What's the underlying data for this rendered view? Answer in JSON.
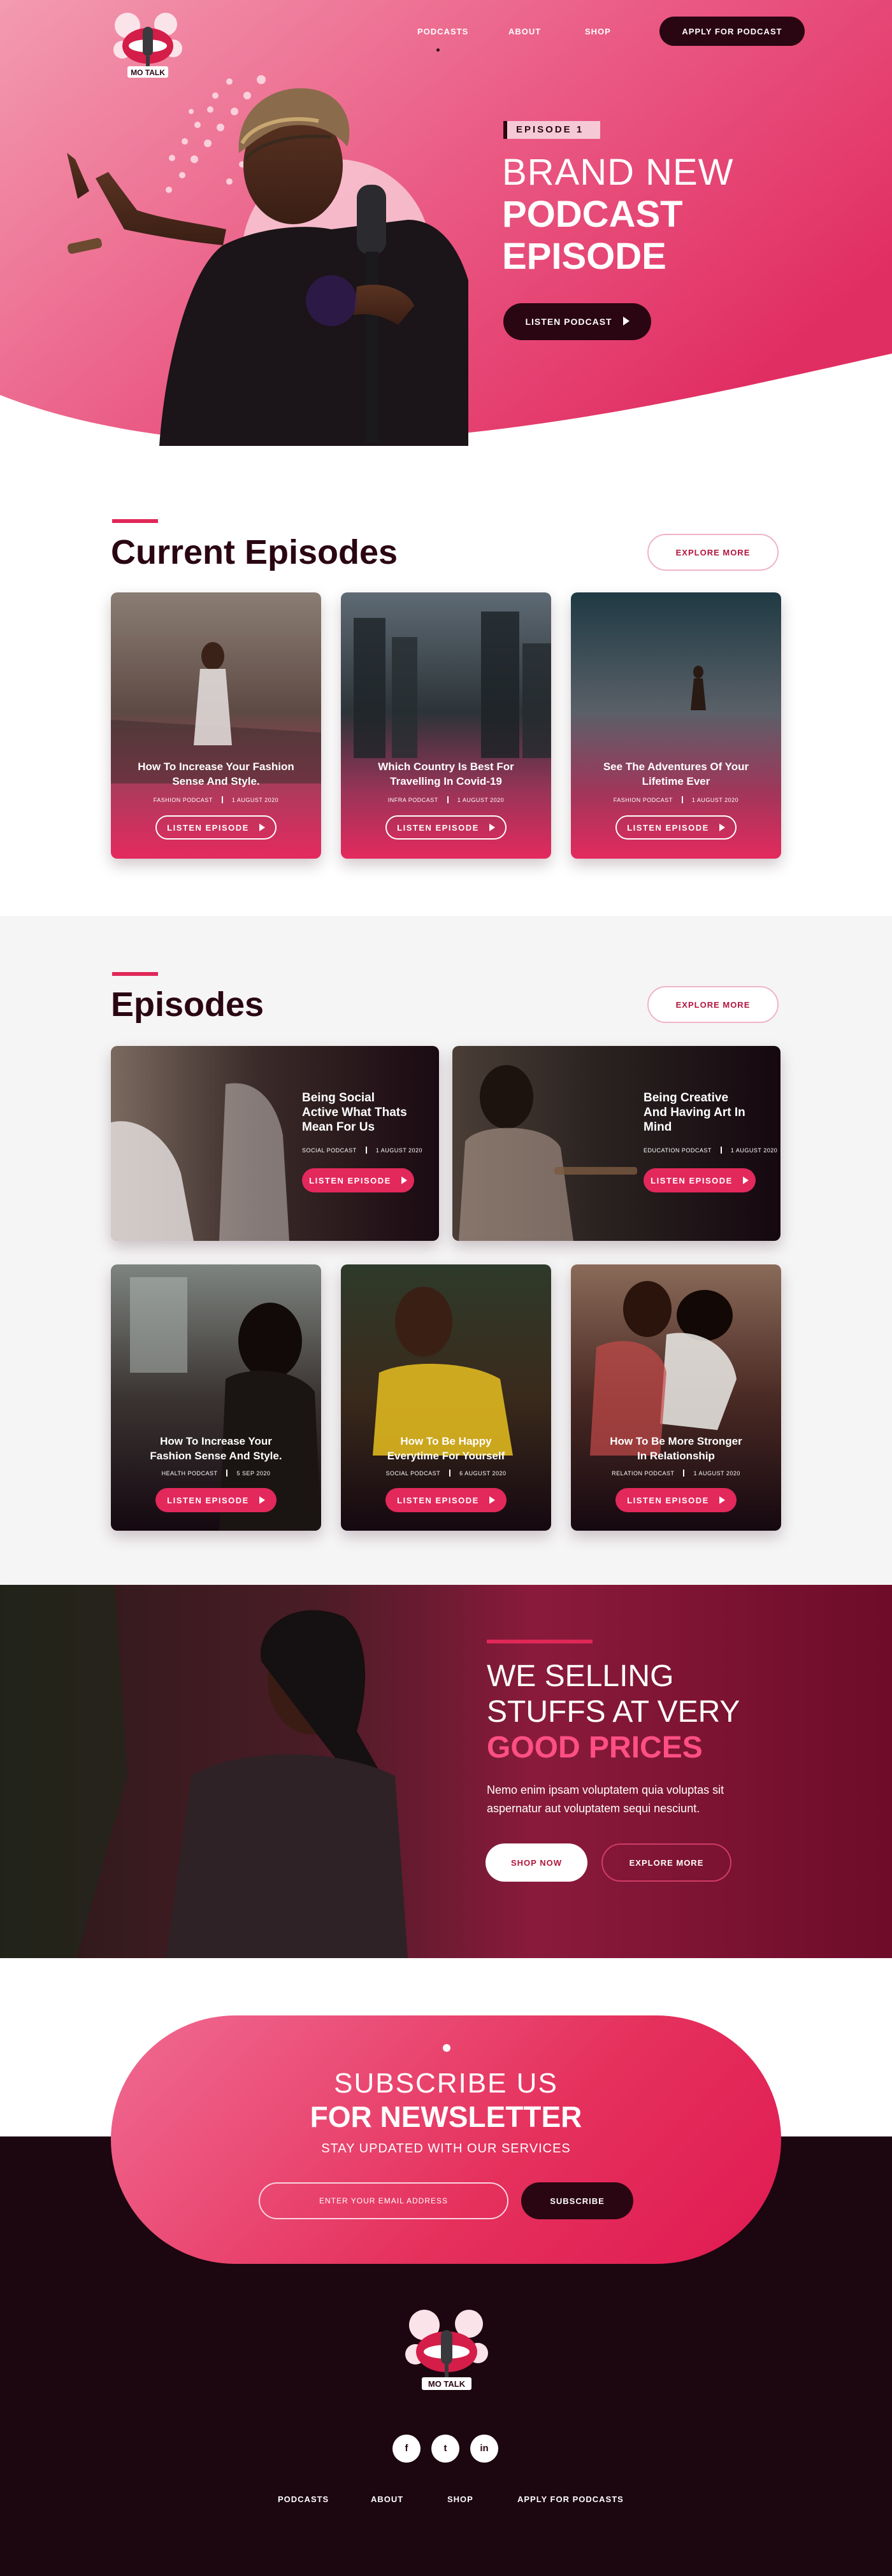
{
  "nav": {
    "items": [
      {
        "label": "PODCASTS"
      },
      {
        "label": "ABOUT"
      },
      {
        "label": "SHOP"
      }
    ],
    "cta": "APPLY FOR PODCAST"
  },
  "logo": {
    "text": "MO TALK",
    "icon": "microphone-lips-logo"
  },
  "hero": {
    "badge": "EPISODE 1",
    "title_line1": "BRAND NEW",
    "title_line2": "PODCAST",
    "title_line3": "EPISODE",
    "button": "LISTEN PODCAST",
    "image": "woman-singing-into-microphone-photo"
  },
  "current": {
    "title": "Current Episodes",
    "explore": "EXPLORE MORE",
    "cards": [
      {
        "title1": "How To Increase Your Fashion",
        "title2": "Sense And Style.",
        "category": "FASHION PODCAST",
        "date": "1 AUGUST 2020",
        "button": "LISTEN EPISODE"
      },
      {
        "title1": "Which Country Is Best For",
        "title2": "Travelling In Covid-19",
        "category": "INFRA PODCAST",
        "date": "1 AUGUST 2020",
        "button": "LISTEN EPISODE"
      },
      {
        "title1": "See The Adventures Of Your",
        "title2": "Lifetime Ever",
        "category": "FASHION PODCAST",
        "date": "1 AUGUST 2020",
        "button": "LISTEN EPISODE"
      }
    ]
  },
  "episodes": {
    "title": "Episodes",
    "explore": "EXPLORE MORE",
    "wide": [
      {
        "l1": "Being Social",
        "l2": "Active What Thats",
        "l3": "Mean For Us",
        "category": "SOCIAL PODCAST",
        "date": "1 AUGUST 2020",
        "button": "LISTEN EPISODE"
      },
      {
        "l1": "Being Creative",
        "l2": "And Having Art In",
        "l3": "Mind",
        "category": "EDUCATION PODCAST",
        "date": "1 AUGUST 2020",
        "button": "LISTEN EPISODE"
      }
    ],
    "cards": [
      {
        "title1": "How To Increase Your",
        "title2": "Fashion Sense And Style.",
        "category": "HEALTH PODCAST",
        "date": "5 SEP 2020",
        "button": "LISTEN EPISODE"
      },
      {
        "title1": "How To Be Happy",
        "title2": "Everytime For Yourself",
        "category": "SOCIAL PODCAST",
        "date": "6 AUGUST 2020",
        "button": "LISTEN EPISODE"
      },
      {
        "title1": "How To Be More Stronger",
        "title2": "In Relationship",
        "category": "RELATION PODCAST",
        "date": "1 AUGUST 2020",
        "button": "LISTEN EPISODE"
      }
    ]
  },
  "promo": {
    "line1": "WE SELLING",
    "line2": "STUFFS AT VERY",
    "line3": "GOOD PRICES",
    "desc1": "Nemo enim ipsam voluptatem quia voluptas sit",
    "desc2": "aspernatur aut voluptatem sequi nesciunt.",
    "shop": "SHOP NOW",
    "explore": "EXPLORE MORE"
  },
  "newsletter": {
    "line1": "SUBSCRIBE US",
    "line2": "FOR NEWSLETTER",
    "sub": "STAY UPDATED WITH OUR SERVICES",
    "placeholder": "ENTER YOUR EMAIL ADDRESS",
    "button": "SUBSCRIBE"
  },
  "footer": {
    "social": [
      {
        "label": "f",
        "icon": "facebook-icon"
      },
      {
        "label": "t",
        "icon": "twitter-icon"
      },
      {
        "label": "in",
        "icon": "linkedin-icon"
      }
    ],
    "nav": [
      "PODCASTS",
      "ABOUT",
      "SHOP",
      "APPLY FOR PODCASTS"
    ]
  },
  "colors": {
    "brand_pink": "#e3285c",
    "dark_maroon": "#2a0612",
    "light_pink": "#f6c9d6"
  }
}
